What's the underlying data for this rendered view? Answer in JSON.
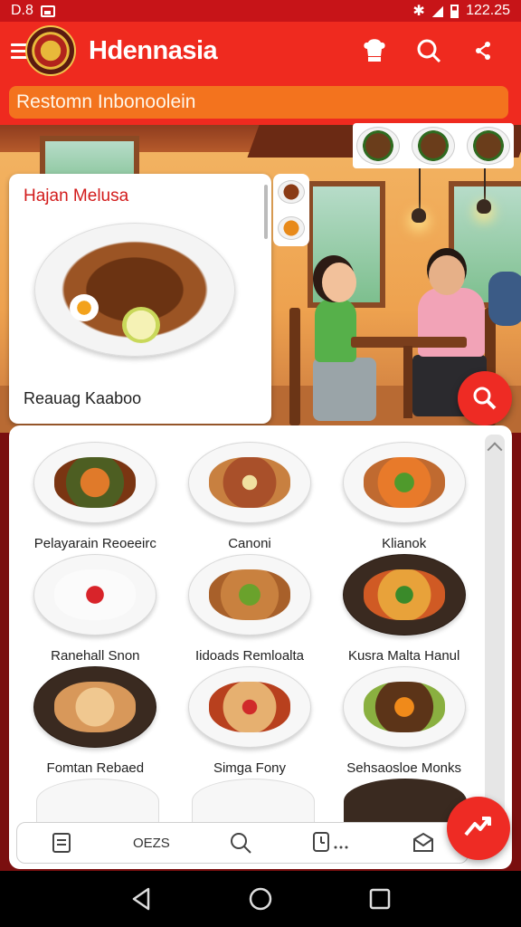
{
  "status_bar": {
    "time_left": "D.8",
    "time_right": "122.25"
  },
  "app_bar": {
    "title": "Hdennasia"
  },
  "sub_header": {
    "text": "Restomn Inbonoolein"
  },
  "featured": {
    "title": "Hajan Melusa",
    "caption": "Reauag Kaaboo"
  },
  "dishes": [
    {
      "label": "Pelayarain Reoeeirc"
    },
    {
      "label": "Canoni"
    },
    {
      "label": "Klianok"
    },
    {
      "label": "Ranehall Snon"
    },
    {
      "label": "Iidoads Remloalta"
    },
    {
      "label": "Kusra Malta Hanul"
    },
    {
      "label": "Fomtan Rebaed"
    },
    {
      "label": "Simga Fony"
    },
    {
      "label": "Sehsaosloe Monks"
    }
  ],
  "tab_bar": {
    "items": [
      "",
      "OEZS",
      "",
      "",
      ""
    ]
  },
  "colors": {
    "primary": "#ef2a1f",
    "accent": "#f3731e",
    "fab": "#ee2b24"
  },
  "icons": [
    "hamburger-icon",
    "chef-icon",
    "search-icon",
    "share-icon",
    "list-icon",
    "search-icon",
    "clock-icon",
    "mail-icon",
    "back-icon",
    "home-icon",
    "recents-icon"
  ]
}
